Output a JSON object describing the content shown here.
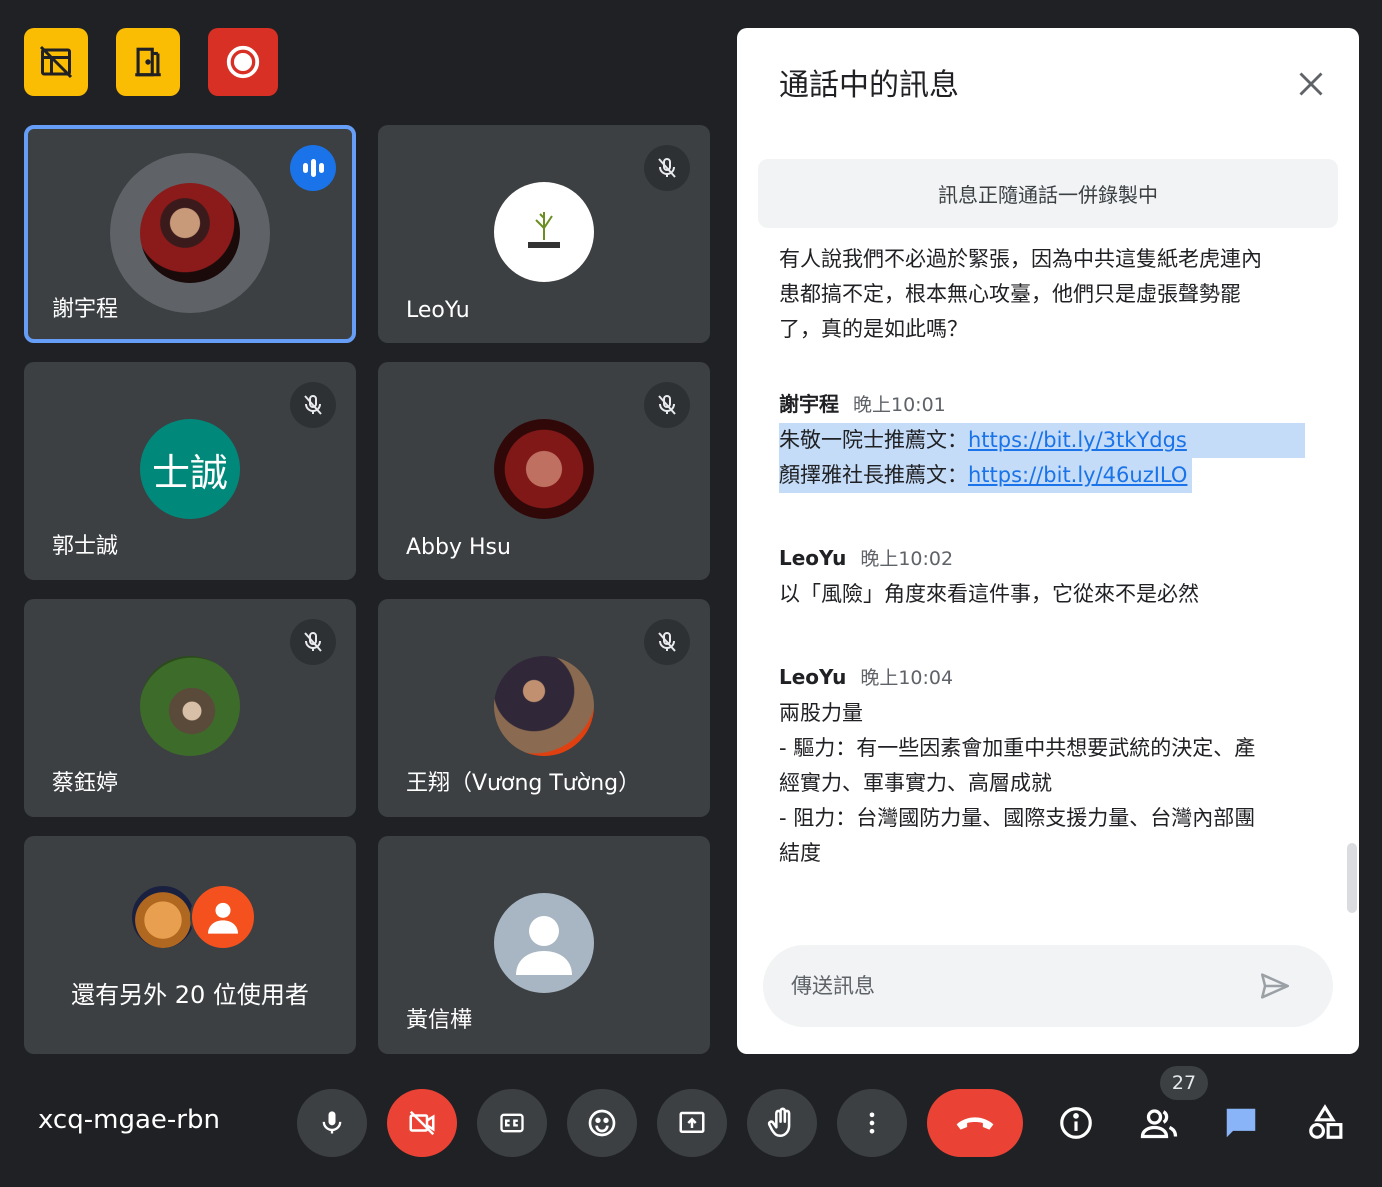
{
  "colors": {
    "background": "#202124",
    "tile": "#3c4043",
    "accent_blue": "#1a73e8",
    "active_outline": "#669df6",
    "danger": "#ea4335",
    "warning": "#fbbc04"
  },
  "top_badges": [
    {
      "icon": "no-layout-icon",
      "color": "#fbbc04"
    },
    {
      "icon": "door-icon",
      "color": "#fbbc04"
    },
    {
      "icon": "record-icon",
      "color": "#d93025"
    }
  ],
  "participants": [
    {
      "name": "謝宇程",
      "state": "speaking",
      "avatar_icon": "photo-avatar"
    },
    {
      "name": "LeoYu",
      "state": "muted",
      "avatar_icon": "logo-avatar"
    },
    {
      "name": "郭士誠",
      "state": "muted",
      "avatar_text": "士誠",
      "avatar_color": "#00897b"
    },
    {
      "name": "Abby Hsu",
      "state": "muted",
      "avatar_icon": "photo-avatar"
    },
    {
      "name": "蔡鈺婷",
      "state": "muted",
      "avatar_icon": "photo-avatar"
    },
    {
      "name": "王翔（Vương Tường）",
      "state": "muted",
      "avatar_icon": "photo-avatar"
    },
    {
      "name": "黃信樺",
      "state": "none",
      "avatar_icon": "person-silhouette"
    }
  ],
  "more_users": {
    "label": "還有另外 20 位使用者"
  },
  "chat": {
    "title": "通話中的訊息",
    "recording_note": "訊息正隨通話一併錄製中",
    "first_message": "有人說我們不必過於緊張，因為中共這隻紙老虎連內\n患都搞不定，根本無心攻臺，他們只是虛張聲勢罷\n了，真的是如此嗎？",
    "messages": [
      {
        "sender": "謝宇程",
        "time": "晚上10:01",
        "line1_prefix": "朱敬一院士推薦文：",
        "line1_link": "https://bit.ly/3tkYdgs",
        "line2_prefix": "顏擇雅社長推薦文：",
        "line2_link": "https://bit.ly/46uzILO"
      },
      {
        "sender": "LeoYu",
        "time": "晚上10:02",
        "text": "以「風險」角度來看這件事，它從來不是必然"
      },
      {
        "sender": "LeoYu",
        "time": "晚上10:04",
        "text": "兩股力量\n- 驅力：有一些因素會加重中共想要武統的決定、產\n經實力、軍事實力、高層成就\n- 阻力：台灣國防力量、國際支援力量、台灣內部團\n結度"
      }
    ],
    "input_placeholder": "傳送訊息"
  },
  "bottom_bar": {
    "meeting_code": "xcq-mgae-rbn",
    "participants_count": "27"
  }
}
